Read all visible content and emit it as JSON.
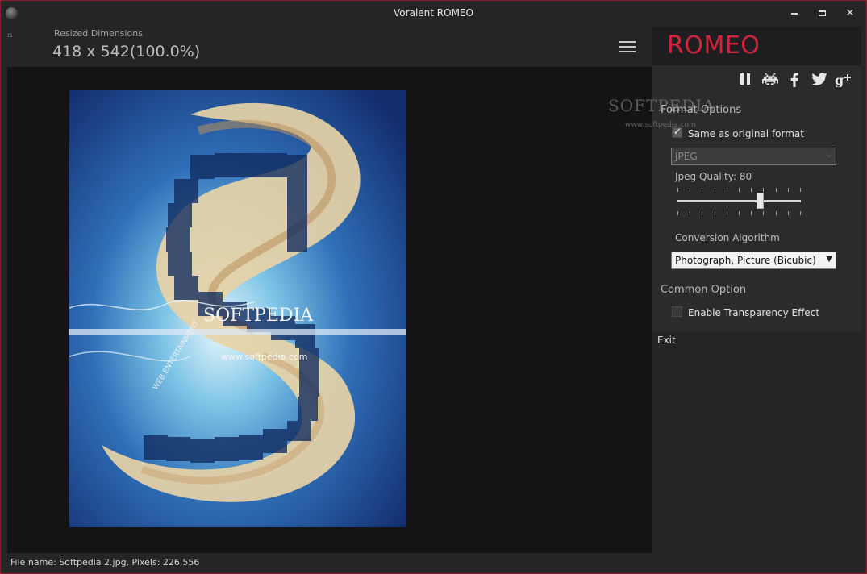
{
  "window": {
    "title": "Voralent ROMEO"
  },
  "header": {
    "left_fragment": "ıs",
    "resized_dimensions_label": "Resized Dimensions",
    "resized_dimensions_value": "418 x 542(100.0%)"
  },
  "preview": {
    "logo_text": "SOFTPEDIA",
    "logo_url": "www.softpedia.com",
    "logo_side_text": "WEB ENTERTAINMENT"
  },
  "panel": {
    "brand": "ROMEO",
    "social_icons": [
      "pause-icon",
      "invader-icon",
      "facebook-icon",
      "twitter-icon",
      "google-plus-icon"
    ],
    "format_options_title": "Format Options",
    "same_as_original_label": "Same as original format",
    "same_as_original_checked": true,
    "format_select_value": "JPEG",
    "jpeg_quality_label": "Jpeg Quality: 80",
    "jpeg_quality": 80,
    "conversion_algorithm_label": "Conversion Algorithm",
    "conversion_algorithm_value": "Photograph, Picture (Bicubic)",
    "common_option_title": "Common Option",
    "transparency_label": "Enable Transparency Effect",
    "transparency_checked": false
  },
  "exit_label": "Exit",
  "watermark": {
    "text": "SOFTPEDIA",
    "url": "www.softpedia.com"
  },
  "status": {
    "text": "File name: Softpedia 2.jpg, Pixels: 226,556"
  },
  "colors": {
    "brand_red": "#d3243b",
    "window_border": "#8c1d2e",
    "background": "#252527"
  }
}
